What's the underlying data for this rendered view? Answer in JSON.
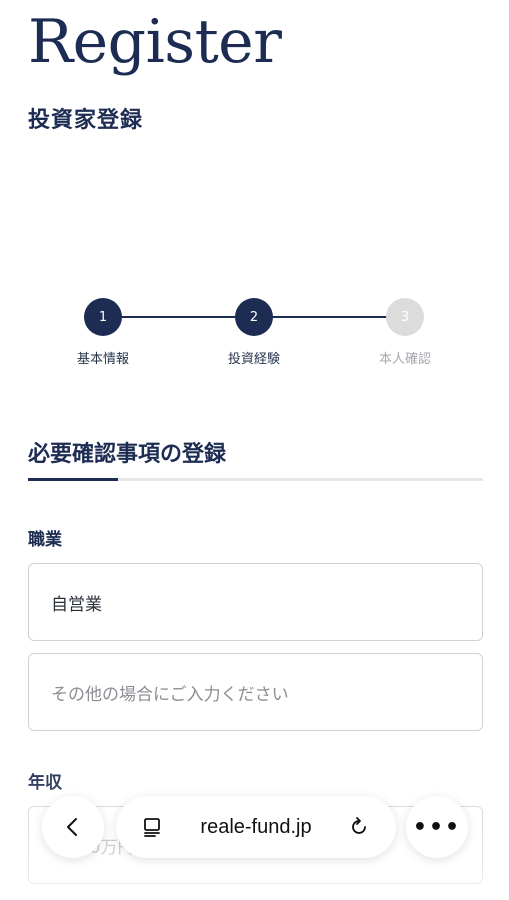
{
  "hero": {
    "title": "Register",
    "subtitle": "投資家登録"
  },
  "stepper": {
    "steps": [
      {
        "number": "1",
        "label": "基本情報",
        "state": "done"
      },
      {
        "number": "2",
        "label": "投資経験",
        "state": "current"
      },
      {
        "number": "3",
        "label": "本人確認",
        "state": "todo"
      }
    ]
  },
  "section": {
    "title": "必要確認事項の登録"
  },
  "form": {
    "occupation": {
      "label": "職業",
      "value": "自営業",
      "other_placeholder": "その他の場合にご入力ください"
    },
    "income": {
      "label": "年収",
      "value": "～300万円未満"
    }
  },
  "browser": {
    "url": "reale-fund.jp",
    "back_icon": "chevron-left-icon",
    "tabs_icon": "tabs-icon",
    "reload_icon": "reload-icon",
    "more_icon": "more-icon"
  },
  "colors": {
    "accent": "#1d2c52",
    "inactive": "#dcdcdc"
  }
}
